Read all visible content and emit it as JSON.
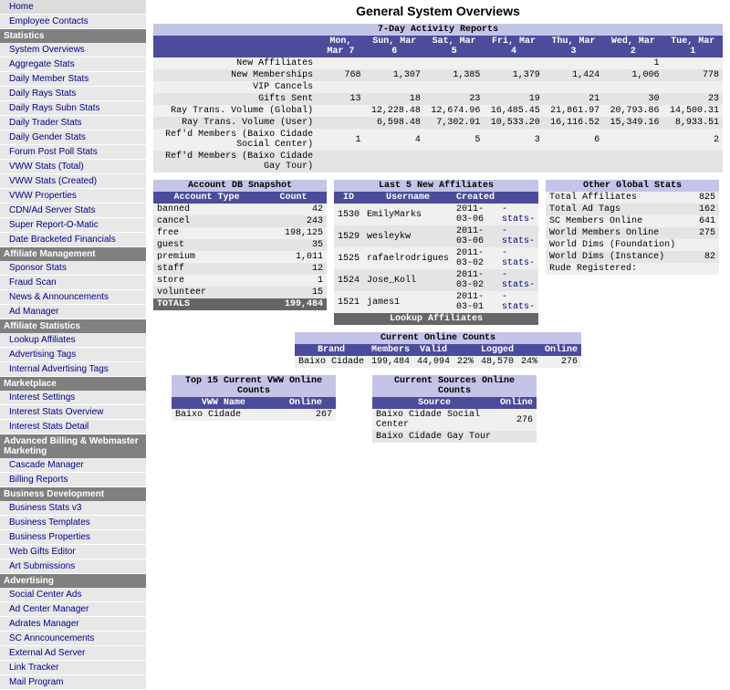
{
  "page_title": "General System Overviews",
  "nav": {
    "top": [
      "Home",
      "Employee Contacts"
    ],
    "sections": [
      {
        "header": "Statistics",
        "items": [
          "System Overviews",
          "Aggregate Stats",
          "Daily Member Stats",
          "Daily Rays Stats",
          "Daily Rays Subn Stats",
          "Daily Trader Stats",
          "Daily Gender Stats",
          "Forum Post Poll Stats",
          "VWW Stats (Total)",
          "VWW Stats (Created)",
          "VWW Properties",
          "CDN/Ad Server Stats",
          "Super Report-O-Matic",
          "Date Bracketed Financials"
        ]
      },
      {
        "header": "Affiliate Management",
        "items": [
          "Sponsor Stats",
          "Fraud Scan",
          "News & Announcements",
          "Ad Manager"
        ]
      },
      {
        "header": "Affiliate Statistics",
        "items": [
          "Lookup Affiliates",
          "Advertising Tags",
          "Internal Advertising Tags"
        ]
      },
      {
        "header": "Marketplace",
        "items": [
          "Interest Settings",
          "Interest Stats Overview",
          "Interest Stats Detail"
        ]
      },
      {
        "header": "Advanced Billing & Webmaster Marketing",
        "items": [
          "Cascade Manager",
          "Billing Reports"
        ]
      },
      {
        "header": "Business Development",
        "items": [
          "Business Stats v3",
          "Business Templates",
          "Business Properties",
          "Web Gifts Editor",
          "Art Submissions"
        ]
      },
      {
        "header": "Advertising",
        "items": [
          "Social Center Ads",
          "Ad Center Manager",
          "Adrates Manager",
          "SC Anncouncements",
          "External Ad Server",
          "Link Tracker",
          "Mail Program"
        ]
      }
    ]
  },
  "activity": {
    "title": "7-Day Activity Reports",
    "cols": [
      "Mon, Mar 7",
      "Sun, Mar 6",
      "Sat, Mar 5",
      "Fri, Mar 4",
      "Thu, Mar 3",
      "Wed, Mar 2",
      "Tue, Mar 1"
    ],
    "rows": [
      {
        "label": "New Affiliates",
        "vals": [
          "",
          "",
          "",
          "",
          "",
          "1",
          ""
        ]
      },
      {
        "label": "New Memberships",
        "vals": [
          "768",
          "1,307",
          "1,385",
          "1,379",
          "1,424",
          "1,006",
          "778"
        ]
      },
      {
        "label": "VIP Cancels",
        "vals": [
          "",
          "",
          "",
          "",
          "",
          "",
          ""
        ]
      },
      {
        "label": "Gifts Sent",
        "vals": [
          "13",
          "18",
          "23",
          "19",
          "21",
          "30",
          "23"
        ]
      },
      {
        "label": "Ray Trans. Volume (Global)",
        "vals": [
          "",
          "12,228.48",
          "12,674.96",
          "16,485.45",
          "21,861.97",
          "20,793.86",
          "14,500.31"
        ]
      },
      {
        "label": "Ray Trans. Volume (User)",
        "vals": [
          "",
          "6,598.48",
          "7,302.91",
          "10,533.20",
          "16,116.52",
          "15,349.16",
          "8,933.51"
        ]
      },
      {
        "label": "Ref'd Members (Baixo Cidade Social Center)",
        "vals": [
          "1",
          "4",
          "5",
          "3",
          "6",
          "",
          "2"
        ]
      },
      {
        "label": "Ref'd Members (Baixo Cidade Gay Tour)",
        "vals": [
          "",
          "",
          "",
          "",
          "",
          "",
          ""
        ]
      }
    ]
  },
  "snapshot": {
    "title": "Account DB Snapshot",
    "cols": [
      "Account Type",
      "Count"
    ],
    "rows": [
      [
        "banned",
        "42"
      ],
      [
        "cancel",
        "243"
      ],
      [
        "free",
        "198,125"
      ],
      [
        "guest",
        "35"
      ],
      [
        "premium",
        "1,011"
      ],
      [
        "staff",
        "12"
      ],
      [
        "store",
        "1"
      ],
      [
        "volunteer",
        "15"
      ]
    ],
    "totals_label": "TOTALS",
    "totals_value": "199,484"
  },
  "affiliates": {
    "title": "Last 5 New Affiliates",
    "cols": [
      "ID",
      "Username",
      "Created",
      ""
    ],
    "rows": [
      [
        "1530",
        "EmilyMarks",
        "2011-03-06",
        "-stats-"
      ],
      [
        "1529",
        "wesleykw",
        "2011-03-06",
        "-stats-"
      ],
      [
        "1525",
        "rafaelrodrigues",
        "2011-03-02",
        "-stats-"
      ],
      [
        "1524",
        "Jose_Koll",
        "2011-03-02",
        "-stats-"
      ],
      [
        "1521",
        "james1",
        "2011-03-01",
        "-stats-"
      ]
    ],
    "button": "Lookup Affiliates"
  },
  "global": {
    "title": "Other Global Stats",
    "rows": [
      [
        "Total Affiliates",
        "825"
      ],
      [
        "Total Ad Tags",
        "162"
      ],
      [
        "SC Members Online",
        "641"
      ],
      [
        "World Members Online",
        "275"
      ],
      [
        "World Dims (Foundation)",
        ""
      ],
      [
        "World Dims (Instance)",
        "82"
      ],
      [
        "Rude Registered:",
        ""
      ]
    ]
  },
  "online": {
    "title": "Current Online Counts",
    "cols": [
      "Brand",
      "Members",
      "Valid",
      "",
      "Logged",
      "",
      "Online"
    ],
    "row": [
      "Baixo Cidade",
      "199,484",
      "44,094",
      "22%",
      "48,570",
      "24%",
      "276"
    ]
  },
  "vww": {
    "title": "Top 15 Current VWW Online Counts",
    "cols": [
      "VWW Name",
      "Online"
    ],
    "rows": [
      [
        "Baixo Cidade",
        "267"
      ]
    ]
  },
  "sources": {
    "title": "Current Sources Online Counts",
    "cols": [
      "Source",
      "Online"
    ],
    "rows": [
      [
        "Baixo Cidade Social Center",
        "276"
      ],
      [
        "Baixo Cidade Gay Tour",
        ""
      ]
    ]
  }
}
